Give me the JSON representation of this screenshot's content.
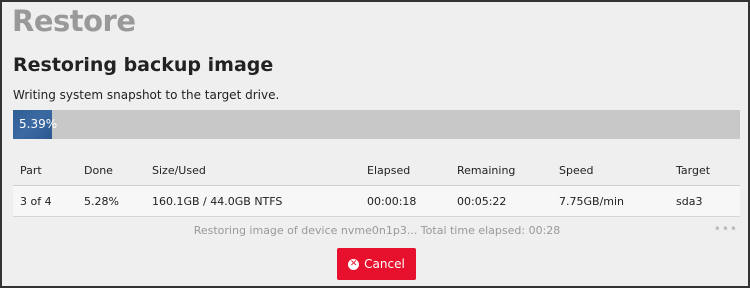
{
  "page": {
    "title": "Restore"
  },
  "section": {
    "title": "Restoring backup image",
    "subtitle": "Writing system snapshot to the target drive."
  },
  "progress": {
    "value": 0.0539,
    "label": "5.39%"
  },
  "table": {
    "headers": [
      "Part",
      "Done",
      "Size/Used",
      "Elapsed",
      "Remaining",
      "Speed",
      "Target"
    ],
    "rows": [
      [
        "3 of 4",
        "5.28%",
        "160.1GB / 44.0GB NTFS",
        "00:00:18",
        "00:05:22",
        "7.75GB/min",
        "sda3"
      ]
    ]
  },
  "status": {
    "text": "Restoring image of device nvme0n1p3... Total time elapsed: 00:28",
    "more": "•••"
  },
  "actions": {
    "cancel_label": "Cancel",
    "cancel_icon": "times-circle-icon",
    "cancel_color": "#e8112d"
  }
}
